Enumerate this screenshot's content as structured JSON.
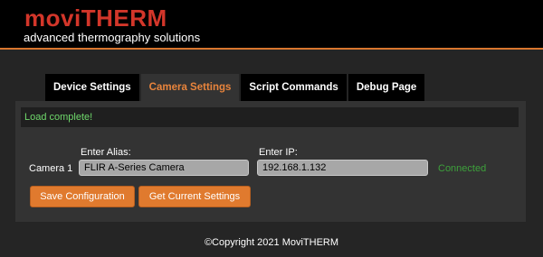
{
  "brand": {
    "logo_prefix": "movi",
    "logo_suffix": "THERM",
    "tagline": "advanced thermography solutions"
  },
  "tabs": [
    {
      "label": "Device Settings",
      "active": false
    },
    {
      "label": "Camera Settings",
      "active": true
    },
    {
      "label": "Script Commands",
      "active": false
    },
    {
      "label": "Debug Page",
      "active": false
    }
  ],
  "status": {
    "message": "Load complete!"
  },
  "camera": {
    "name_label": "Camera 1",
    "alias_label": "Enter Alias:",
    "alias_value": "FLIR A-Series Camera",
    "ip_label": "Enter IP:",
    "ip_value": "192.168.1.132",
    "connection_status": "Connected"
  },
  "actions": {
    "save_label": "Save Configuration",
    "get_label": "Get Current Settings"
  },
  "footer": {
    "copyright": "©Copyright 2021 MoviTHERM"
  },
  "colors": {
    "accent": "#e07a2e",
    "logo_red": "#d3362a",
    "status_green": "#6fd86b",
    "connected_green": "#3da13b"
  }
}
